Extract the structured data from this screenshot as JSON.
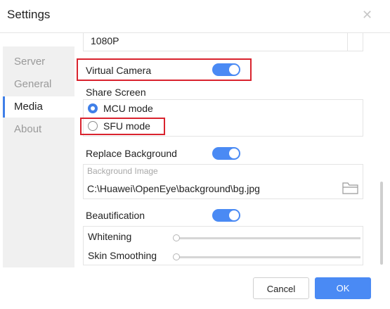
{
  "dialog": {
    "title": "Settings",
    "close_glyph": "✕"
  },
  "sidebar": {
    "items": [
      {
        "label": "Server"
      },
      {
        "label": "General"
      },
      {
        "label": "Media",
        "active": true
      },
      {
        "label": "About"
      }
    ]
  },
  "media": {
    "resolution_value": "1080P",
    "virtual_camera": {
      "label": "Virtual Camera",
      "enabled": true
    },
    "share_screen": {
      "label": "Share Screen",
      "options": [
        {
          "label": "MCU mode",
          "selected": true
        },
        {
          "label": "SFU mode",
          "selected": false
        }
      ]
    },
    "replace_background": {
      "label": "Replace Background",
      "enabled": true,
      "image_label": "Background Image",
      "image_path": "C:\\Huawei\\OpenEye\\background\\bg.jpg"
    },
    "beautification": {
      "label": "Beautification",
      "enabled": true,
      "whitening": {
        "label": "Whitening",
        "value": 0
      },
      "skin_smoothing": {
        "label": "Skin Smoothing",
        "value": 0
      }
    }
  },
  "footer": {
    "cancel_label": "Cancel",
    "ok_label": "OK"
  },
  "colors": {
    "accent": "#4a8af4",
    "highlight_red": "#d9232e"
  }
}
